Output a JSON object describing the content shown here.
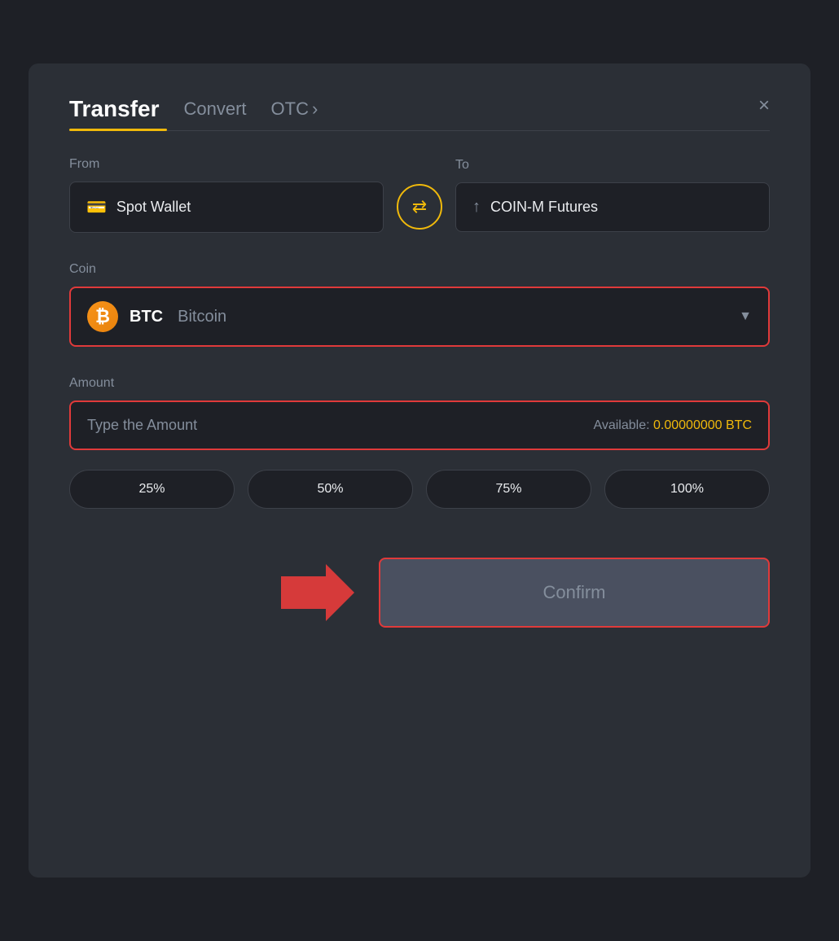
{
  "header": {
    "title": "Transfer",
    "tab_convert": "Convert",
    "tab_otc": "OTC",
    "tab_otc_arrow": "›",
    "close_label": "×"
  },
  "from_section": {
    "label": "From",
    "wallet_icon": "💳",
    "wallet_name": "Spot Wallet"
  },
  "swap_icon": "⇄",
  "to_section": {
    "label": "To",
    "wallet_icon": "↑",
    "wallet_name": "COIN-M Futures"
  },
  "coin_section": {
    "label": "Coin",
    "coin_symbol": "BTC",
    "coin_full_name": "Bitcoin",
    "chevron": "▼"
  },
  "amount_section": {
    "label": "Amount",
    "placeholder": "Type the Amount",
    "available_label": "Available:",
    "available_value": "0.00000000 BTC"
  },
  "percent_buttons": [
    "25%",
    "50%",
    "75%",
    "100%"
  ],
  "confirm_button": {
    "label": "Confirm"
  }
}
